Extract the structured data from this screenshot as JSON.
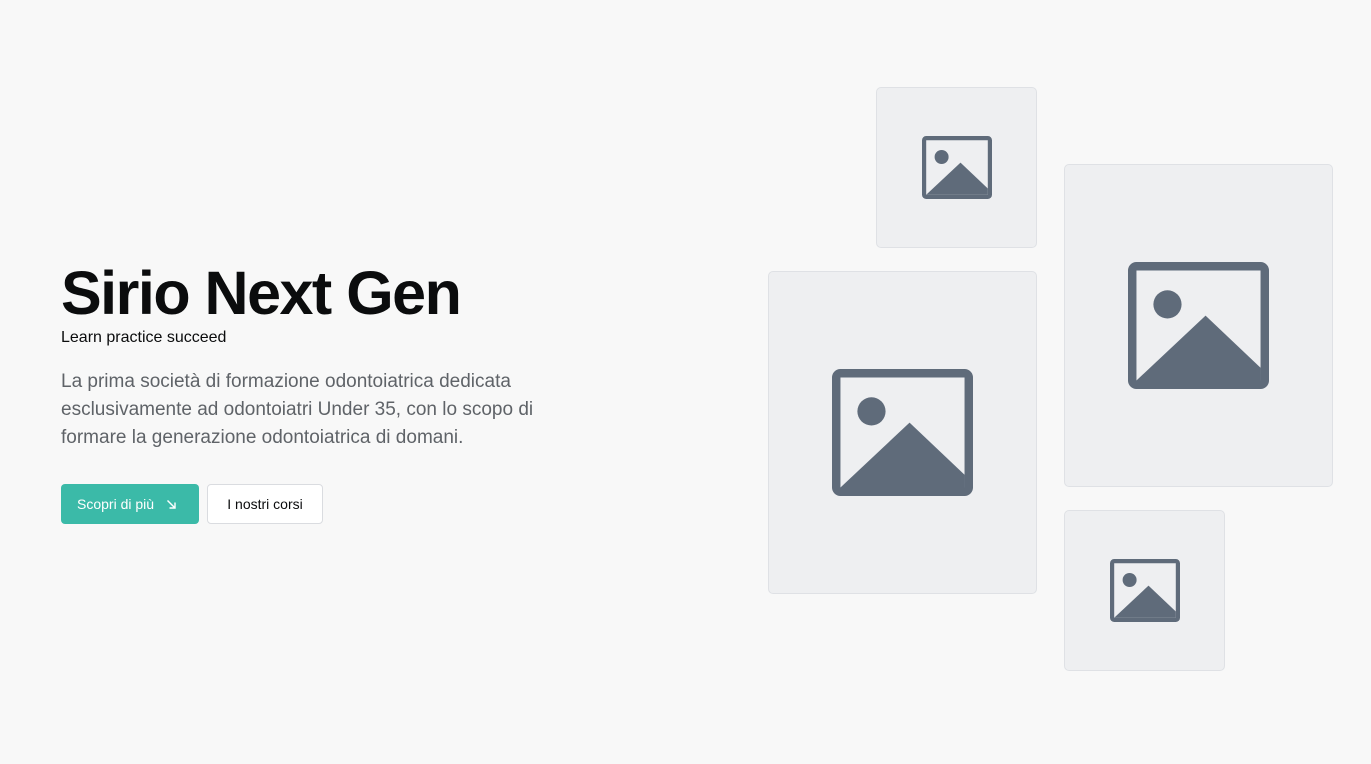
{
  "hero": {
    "title": "Sirio Next Gen",
    "tagline": "Learn practice succeed",
    "description": "La prima società di formazione odontoiatrica dedicata esclusivamente ad odontoiatri Under 35, con lo scopo di formare la generazione odontoiatrica di domani."
  },
  "actions": {
    "primary_label": "Scopri di più",
    "primary_icon": "arrow-down-right-icon",
    "secondary_label": "I nostri corsi"
  },
  "gallery": {
    "placeholder_icon": "image-placeholder-icon"
  },
  "colors": {
    "accent": "#3bbaa8",
    "background": "#f8f8f8",
    "placeholder_bg": "#eeeff1",
    "placeholder_icon": "#5f6b7a"
  }
}
